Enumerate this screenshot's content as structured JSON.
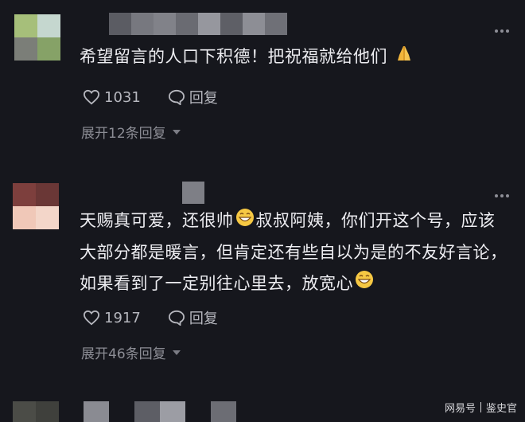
{
  "comments": [
    {
      "text": "希望留言的人口下积德！把祝福就给他们",
      "text_emoji": "pray-hands",
      "likes": "1031",
      "reply_label": "回复",
      "expand_label": "展开12条回复"
    },
    {
      "text_part1": "天赐真可爱，还很帅",
      "text_part2": "叔叔阿姨，你们开这个号，应该大部分都是暖言，但肯定还有些自以为是的不友好言论，如果看到了一定别往心里去，放宽心",
      "likes": "1917",
      "reply_label": "回复",
      "expand_label": "展开46条回复"
    }
  ],
  "watermark": {
    "source": "网易号",
    "author": "鉴史官"
  },
  "colors": {
    "background": "#16171d",
    "text": "#ededf1",
    "muted": "#8c8d95"
  }
}
